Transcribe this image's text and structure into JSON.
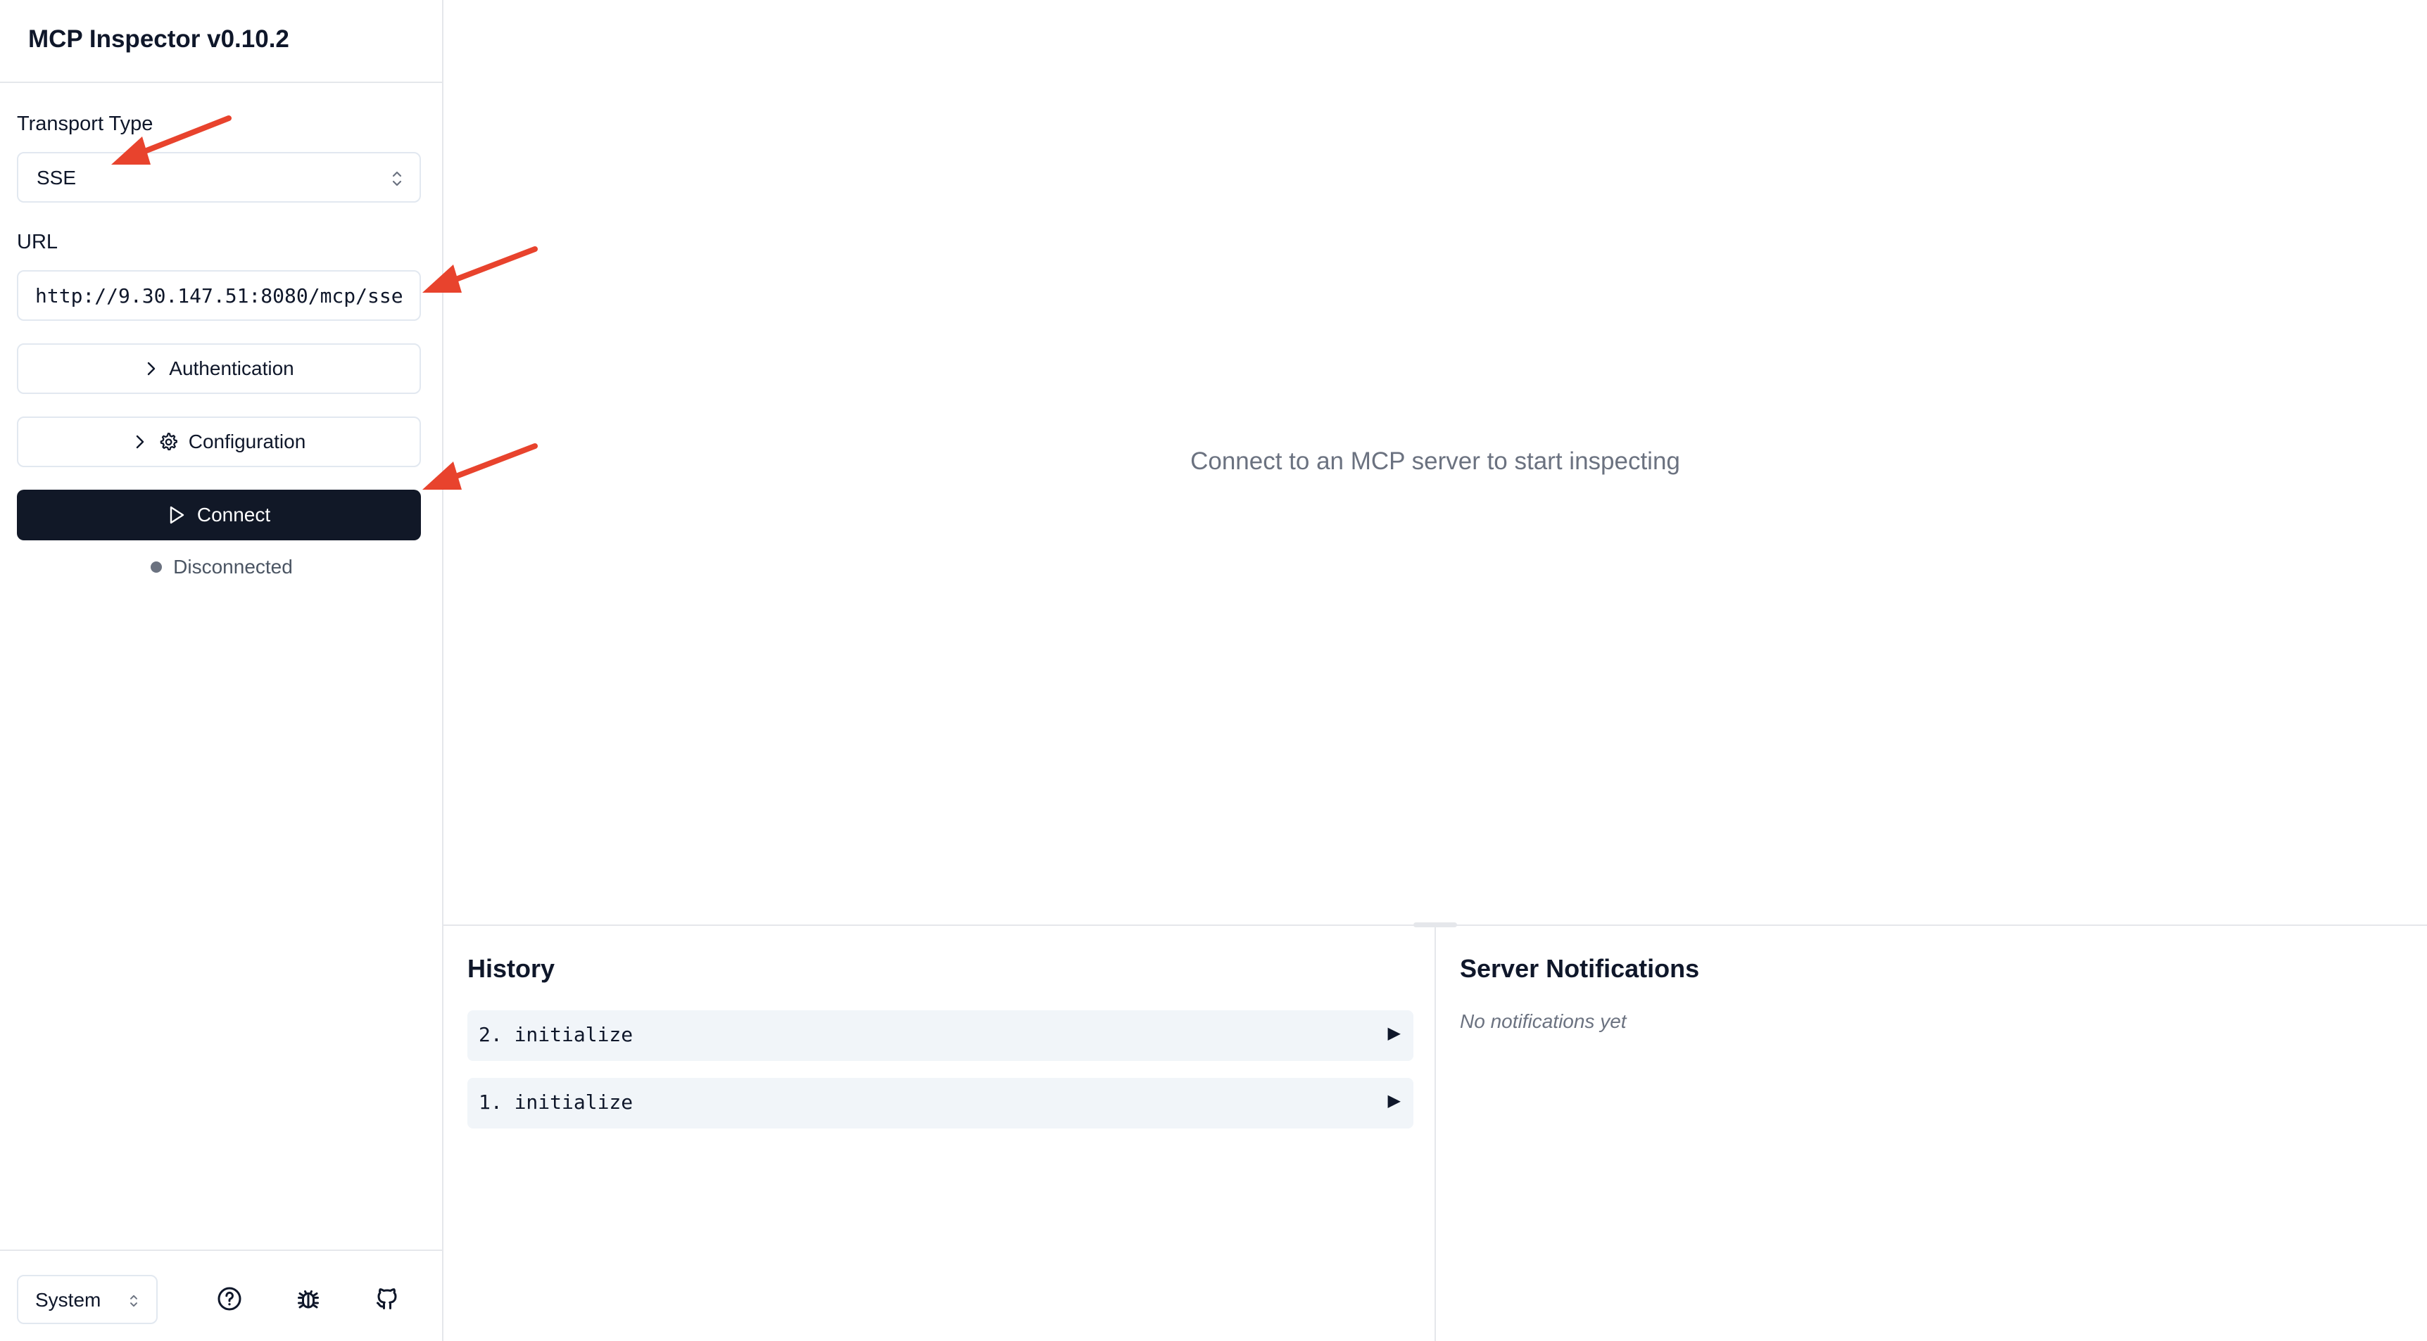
{
  "app": {
    "title": "MCP Inspector v0.10.2"
  },
  "sidebar": {
    "transport_label": "Transport Type",
    "transport_value": "SSE",
    "url_label": "URL",
    "url_value": "http://9.30.147.51:8080/mcp/sse",
    "authentication_label": "Authentication",
    "configuration_label": "Configuration",
    "connect_label": "Connect",
    "status_text": "Disconnected",
    "theme_value": "System",
    "footer_icons": [
      "help-icon",
      "bug-icon",
      "github-icon"
    ]
  },
  "main": {
    "empty_message": "Connect to an MCP server to start inspecting"
  },
  "history": {
    "title": "History",
    "items": [
      {
        "label": "2. initialize"
      },
      {
        "label": "1. initialize"
      }
    ]
  },
  "notifications": {
    "title": "Server Notifications",
    "empty_message": "No notifications yet"
  },
  "colors": {
    "primary_button": "#111827",
    "annotation_arrow": "#e8432d",
    "muted_text": "#6b7280",
    "history_item_bg": "#f1f5f9"
  }
}
